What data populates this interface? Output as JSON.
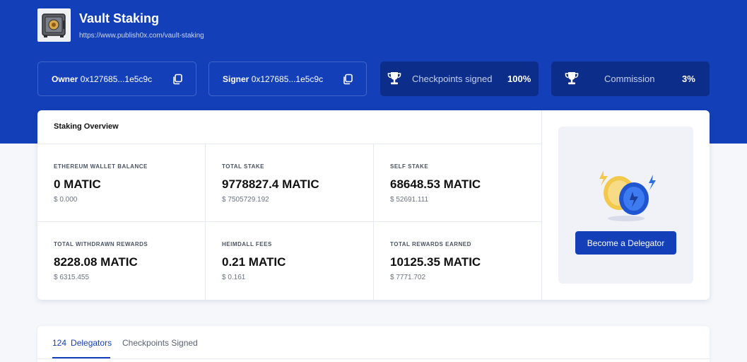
{
  "header": {
    "title": "Vault Staking",
    "url": "https://www.publish0x.com/vault-staking"
  },
  "owner": {
    "label": "Owner",
    "address": "0x127685...1e5c9c"
  },
  "signer": {
    "label": "Signer",
    "address": "0x127685...1e5c9c"
  },
  "checkpoints_card": {
    "label": "Checkpoints signed",
    "value": "100%"
  },
  "commission_card": {
    "label": "Commission",
    "value": "3%"
  },
  "overview": {
    "title": "Staking Overview",
    "stats": [
      {
        "label": "ETHEREUM WALLET BALANCE",
        "value": "0 MATIC",
        "usd": "$ 0.000"
      },
      {
        "label": "TOTAL STAKE",
        "value": "9778827.4 MATIC",
        "usd": "$ 7505729.192"
      },
      {
        "label": "SELF STAKE",
        "value": "68648.53 MATIC",
        "usd": "$ 52691.111"
      },
      {
        "label": "TOTAL WITHDRAWN REWARDS",
        "value": "8228.08 MATIC",
        "usd": "$ 6315.455"
      },
      {
        "label": "HEIMDALL FEES",
        "value": "0.21 MATIC",
        "usd": "$ 0.161"
      },
      {
        "label": "TOTAL REWARDS EARNED",
        "value": "10125.35 MATIC",
        "usd": "$ 7771.702"
      }
    ],
    "delegate_button": "Become a Delegator"
  },
  "tabs": {
    "delegators_count": "124",
    "delegators_label": "Delegators",
    "checkpoints_label": "Checkpoints Signed"
  },
  "icons": [
    "vault-safe-icon",
    "copy-icon",
    "trophy-icon",
    "coin-lightning-icon"
  ],
  "colors": {
    "brand": "#1340b8",
    "card_dark": "#0d2d8a",
    "accent_gold": "#f2c94c"
  }
}
